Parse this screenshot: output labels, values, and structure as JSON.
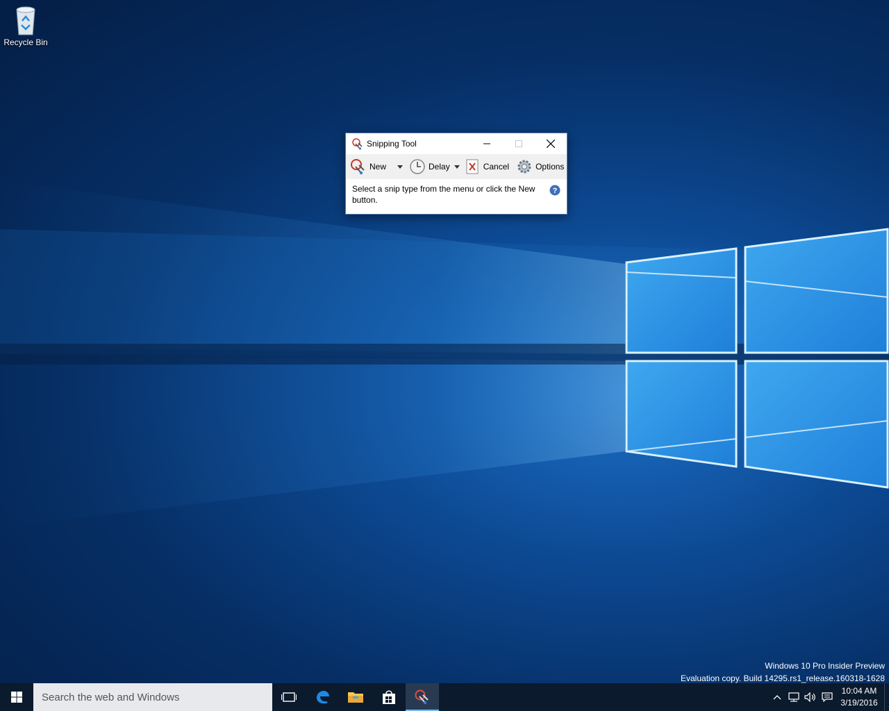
{
  "desktop": {
    "icons": [
      {
        "label": "Recycle Bin",
        "icon": "recycle-bin-icon"
      }
    ]
  },
  "watermark": {
    "line1": "Windows 10 Pro Insider Preview",
    "line2": "Evaluation copy. Build 14295.rs1_release.160318-1628"
  },
  "window": {
    "title": "Snipping Tool",
    "toolbar": {
      "new_label": "New",
      "delay_label": "Delay",
      "cancel_label": "Cancel",
      "options_label": "Options"
    },
    "message": "Select a snip type from the menu or click the New button."
  },
  "taskbar": {
    "search_placeholder": "Search the web and Windows",
    "pinned": [
      "task-view-icon",
      "edge-icon",
      "file-explorer-icon",
      "store-icon",
      "snipping-tool-icon"
    ],
    "clock_time": "10:04 AM",
    "clock_date": "3/19/2016"
  },
  "colors": {
    "taskbar": "#0b1a2c",
    "accent": "#76b9ed",
    "search_bg": "#e7e9ec"
  }
}
